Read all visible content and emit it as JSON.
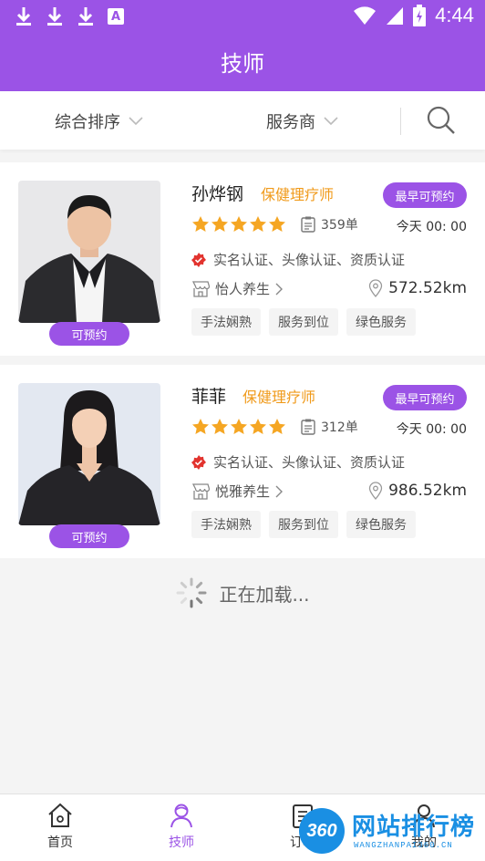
{
  "status_bar": {
    "time": "4:44"
  },
  "header": {
    "title": "技师"
  },
  "filters": {
    "sort_label": "综合排序",
    "provider_label": "服务商"
  },
  "technicians": [
    {
      "name": "孙烨钢",
      "role": "保健理疗师",
      "status_badge": "可预约",
      "book_button": "最早可预约",
      "rating": 5,
      "orders": "359单",
      "available_time": "今天 00: 00",
      "certifications": "实名认证、头像认证、资质认证",
      "shop": "怡人养生",
      "distance": "572.52km",
      "tags": [
        "手法娴熟",
        "服务到位",
        "绿色服务"
      ]
    },
    {
      "name": "菲菲",
      "role": "保健理疗师",
      "status_badge": "可预约",
      "book_button": "最早可预约",
      "rating": 5,
      "orders": "312单",
      "available_time": "今天 00: 00",
      "certifications": "实名认证、头像认证、资质认证",
      "shop": "悦雅养生",
      "distance": "986.52km",
      "tags": [
        "手法娴熟",
        "服务到位",
        "绿色服务"
      ]
    }
  ],
  "loading_text": "正在加载...",
  "tabbar": {
    "items": [
      "首页",
      "技师",
      "订单",
      "我的"
    ],
    "active": "技师"
  },
  "watermark": {
    "title": "网站排行榜",
    "subtitle": "WANGZHANPAI360.CN",
    "badge": "360"
  },
  "colors": {
    "primary": "#9b53e6",
    "accent": "#f09a1a",
    "star": "#f5a623"
  }
}
